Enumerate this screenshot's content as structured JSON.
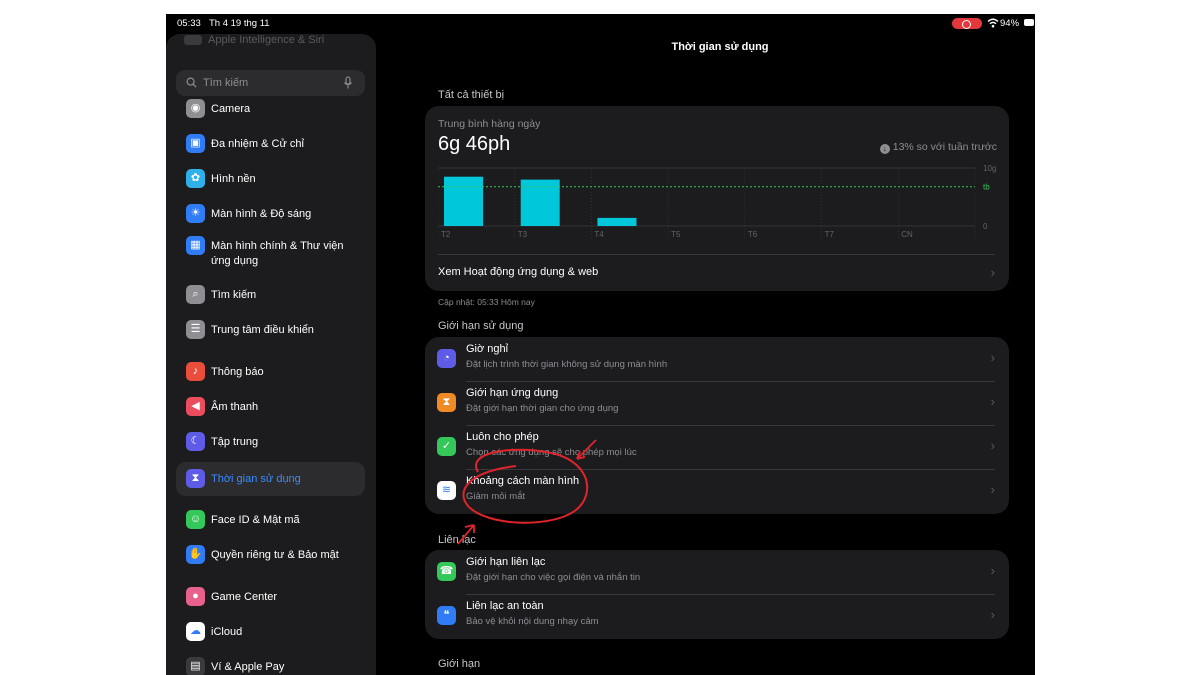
{
  "status_bar": {
    "time": "05:33",
    "date": "Th 4 19 thg 11",
    "battery": "94%"
  },
  "sidebar": {
    "faded_item": "Apple Intelligence & Siri",
    "search_placeholder": "Tìm kiếm",
    "items": [
      {
        "label": "Camera",
        "icon": "camera-icon",
        "color": "#8e8e93",
        "active": false
      },
      {
        "label": "Đa nhiệm & Cử chỉ",
        "icon": "multitasking-icon",
        "color": "#2f7cf6",
        "active": false
      },
      {
        "label": "Hình nền",
        "icon": "wallpaper-icon",
        "color": "#30b0e8",
        "active": false
      },
      {
        "label": "Màn hình & Độ sáng",
        "icon": "brightness-icon",
        "color": "#2f7cf6",
        "active": false
      },
      {
        "label": "Màn hình chính & Thư viện ứng dụng",
        "icon": "home-screen-icon",
        "color": "#2f7cf6",
        "active": false
      },
      {
        "label": "Tìm kiếm",
        "icon": "search-icon",
        "color": "#8e8e93",
        "active": false
      },
      {
        "label": "Trung tâm điều khiển",
        "icon": "control-center-icon",
        "color": "#8e8e93",
        "active": false
      },
      {
        "label": "Thông báo",
        "icon": "bell-icon",
        "color": "#eb4d3d",
        "active": false
      },
      {
        "label": "Âm thanh",
        "icon": "speaker-icon",
        "color": "#eb4d5f",
        "active": false
      },
      {
        "label": "Tập trung",
        "icon": "moon-icon",
        "color": "#5e5ce6",
        "active": false
      },
      {
        "label": "Thời gian sử dụng",
        "icon": "hourglass-icon",
        "color": "#5e5ce6",
        "active": true
      },
      {
        "label": "Face ID & Mật mã",
        "icon": "faceid-icon",
        "color": "#34c759",
        "active": false
      },
      {
        "label": "Quyền riêng tư & Bảo mật",
        "icon": "hand-icon",
        "color": "#2f7cf6",
        "active": false
      },
      {
        "label": "Game Center",
        "icon": "game-center-icon",
        "color": "#e8618c",
        "active": false
      },
      {
        "label": "iCloud",
        "icon": "icloud-icon",
        "color": "#ffffff",
        "active": false
      },
      {
        "label": "Ví & Apple Pay",
        "icon": "wallet-icon",
        "color": "#3a3a3c",
        "active": false
      }
    ]
  },
  "main": {
    "title": "Thời gian sử dụng",
    "all_devices_header": "Tất cả thiết bị",
    "daily_average_label": "Trung bình hàng ngày",
    "daily_average_value": "6g 46ph",
    "compare_text": "13% so với tuần trước",
    "view_activity": "Xem Hoạt động ứng dụng & web",
    "updated": "Cập nhật: 05:33 Hôm nay",
    "limits_header": "Giới hạn sử dụng",
    "limits_rows": [
      {
        "title": "Giờ nghỉ",
        "subtitle": "Đặt lịch trình thời gian không sử dụng màn hình",
        "icon": "downtime-icon",
        "color": "#5e5ce6"
      },
      {
        "title": "Giới hạn ứng dụng",
        "subtitle": "Đặt giới hạn thời gian cho ứng dụng",
        "icon": "hourglass-icon",
        "color": "#f08a24"
      },
      {
        "title": "Luôn cho phép",
        "subtitle": "Chọn các ứng dụng sẽ cho phép mọi lúc",
        "icon": "checkmark-shield-icon",
        "color": "#34c759"
      },
      {
        "title": "Khoảng cách màn hình",
        "subtitle": "Giảm mỏi mắt",
        "icon": "screen-distance-icon",
        "color": "#ffffff"
      }
    ],
    "communication_header": "Liên lạc",
    "communication_rows": [
      {
        "title": "Giới hạn liên lạc",
        "subtitle": "Đặt giới hạn cho việc gọi điện và nhắn tin",
        "icon": "contact-limit-icon",
        "color": "#34c759"
      },
      {
        "title": "Liên lạc an toàn",
        "subtitle": "Bảo vệ khỏi nội dung nhạy cảm",
        "icon": "chat-bubbles-icon",
        "color": "#2f7cf6"
      }
    ],
    "restrictions_header": "Giới hạn"
  },
  "chart_data": {
    "type": "bar",
    "categories": [
      "T2",
      "T3",
      "T4",
      "T5",
      "T6",
      "T7",
      "CN"
    ],
    "values": [
      8.5,
      8.0,
      1.4,
      0,
      0,
      0,
      0
    ],
    "average": 6.77,
    "ytick_labels": [
      "10g",
      "tb",
      "0"
    ],
    "ylim": [
      0,
      10
    ],
    "bar_color": "#00c7d9",
    "average_line_color": "#34c759",
    "grid": true
  },
  "annotation": {
    "color": "#e0242b"
  }
}
